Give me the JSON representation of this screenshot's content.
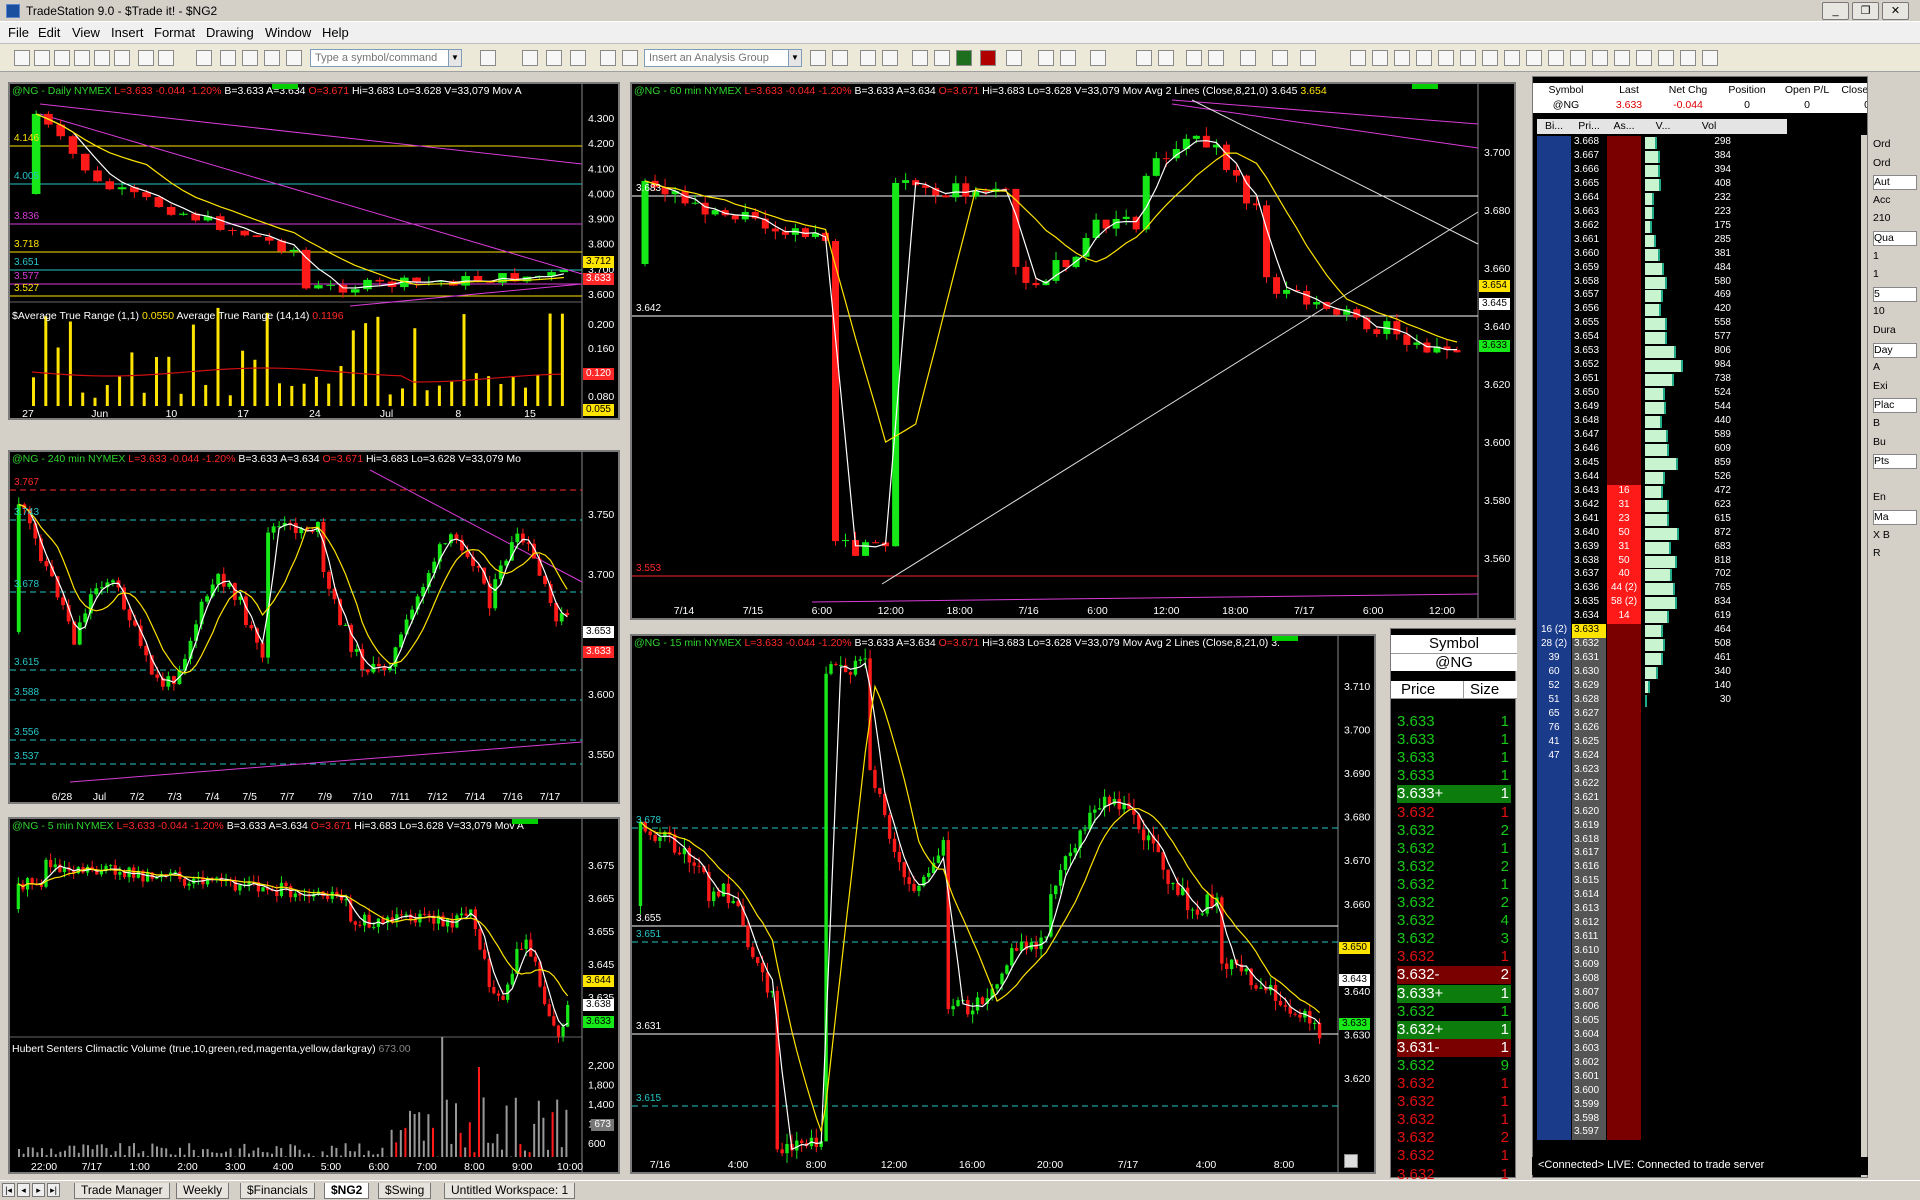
{
  "window": {
    "title": "TradeStation 9.0 - $Trade it! - $NG2",
    "min": "_",
    "max": "❐",
    "close": "✕"
  },
  "menu": [
    "File",
    "Edit",
    "View",
    "Insert",
    "Format",
    "Drawing",
    "Window",
    "Help"
  ],
  "toolbar": {
    "symbol_placeholder": "Type a symbol/command",
    "analysis_placeholder": "Insert an Analysis Group"
  },
  "charts": {
    "daily": {
      "title": "@NG - Daily NYMEX",
      "L": "L=3.633",
      "chg": "-0.044",
      "pct": "-1.20%",
      "B": "B=3.633",
      "A": "A=3.634",
      "O": "O=3.671",
      "Hi": "Hi=3.683",
      "Lo": "Lo=3.628",
      "V": "V=33,079",
      "extra": "Mov A",
      "levels": [
        {
          "v": "4.146",
          "c": "#ffe400"
        },
        {
          "v": "4.005",
          "c": "#27c6c6"
        },
        {
          "v": "3.836",
          "c": "#d83cd8"
        },
        {
          "v": "3.718",
          "c": "#ffe400"
        },
        {
          "v": "3.651",
          "c": "#27c6c6"
        },
        {
          "v": "3.577",
          "c": "#d83cd8"
        },
        {
          "v": "3.527",
          "c": "#ffe400"
        }
      ],
      "axis": [
        "4.300",
        "4.200",
        "4.100",
        "4.000",
        "3.900",
        "3.800",
        "3.700",
        "3.600"
      ],
      "x_labels": [
        "27",
        "Jun",
        "10",
        "17",
        "24",
        "Jul",
        "8",
        "15"
      ],
      "price_tags": {
        "yellow": "3.712",
        "red": "3.633"
      },
      "atr_text": "$Average True Range (1,1)",
      "atr1": "0.0550",
      "atr_text2": "Average True Range (14,14)",
      "atr2": "0.1196",
      "atr_axis": [
        "0.200",
        "0.160",
        "0.120",
        "0.080"
      ],
      "atr_tag_red": "0.120",
      "atr_tag_y": "0.055"
    },
    "h240": {
      "title": "@NG - 240 min NYMEX",
      "L": "L=3.633",
      "chg": "-0.044",
      "pct": "-1.20%",
      "B": "B=3.633",
      "A": "A=3.634",
      "O": "O=3.671",
      "Hi": "Hi=3.683",
      "Lo": "Lo=3.628",
      "V": "V=33,079",
      "extra": "Mo",
      "levels": [
        {
          "v": "3.767",
          "c": "#ff2828"
        },
        {
          "v": "3.743",
          "c": "#27c6c6"
        },
        {
          "v": "3.678",
          "c": "#27c6c6"
        },
        {
          "v": "3.615",
          "c": "#27c6c6"
        },
        {
          "v": "3.588",
          "c": "#27c6c6"
        },
        {
          "v": "3.556",
          "c": "#27c6c6"
        },
        {
          "v": "3.537",
          "c": "#27c6c6"
        }
      ],
      "axis": [
        "3.750",
        "3.700",
        "3.650",
        "3.600",
        "3.550"
      ],
      "x_labels": [
        "6/28",
        "Jul",
        "7/2",
        "7/3",
        "7/4",
        "7/5",
        "7/7",
        "7/9",
        "7/10",
        "7/11",
        "7/12",
        "7/14",
        "7/16",
        "7/17"
      ],
      "price_tags": {
        "white": "3.653",
        "red": "3.633"
      }
    },
    "m5": {
      "title": "@NG - 5 min NYMEX",
      "L": "L=3.633",
      "chg": "-0.044",
      "pct": "-1.20%",
      "B": "B=3.633",
      "A": "A=3.634",
      "O": "O=3.671",
      "Hi": "Hi=3.683",
      "Lo": "Lo=3.628",
      "V": "V=33,079",
      "extra": "Mov A",
      "axis": [
        "3.675",
        "3.665",
        "3.655",
        "3.645",
        "3.635"
      ],
      "x_labels": [
        "22:00",
        "7/17",
        "1:00",
        "2:00",
        "3:00",
        "4:00",
        "5:00",
        "6:00",
        "7:00",
        "8:00",
        "9:00",
        "10:00"
      ],
      "price_tags": {
        "yellow": "3.644",
        "white": "3.638",
        "green": "3.633"
      },
      "vol_text": "Hubert Senters Climactic Volume (true,10,green,red,magenta,yellow,darkgray)",
      "vol_val": "673.00",
      "vol_axis": [
        "2,200",
        "1,800",
        "1,400",
        "1,000",
        "600"
      ],
      "vol_tag": "673"
    },
    "m60": {
      "title": "@NG - 60 min NYMEX",
      "L": "L=3.633",
      "chg": "-0.044",
      "pct": "-1.20%",
      "B": "B=3.633",
      "A": "A=3.634",
      "O": "O=3.671",
      "Hi": "Hi=3.683",
      "Lo": "Lo=3.628",
      "V": "V=33,079",
      "extra": "Mov Avg 2 Lines (Close,8,21,0)",
      "ma1": "3.645",
      "ma2": "3.654",
      "levels": [
        {
          "v": "3.683",
          "c": "#ffffff"
        },
        {
          "v": "3.642",
          "c": "#ffffff"
        },
        {
          "v": "3.553",
          "c": "#ff2828"
        }
      ],
      "axis": [
        "3.700",
        "3.680",
        "3.660",
        "3.640",
        "3.620",
        "3.600",
        "3.580",
        "3.560"
      ],
      "x_labels": [
        "7/14",
        "7/15",
        "6:00",
        "12:00",
        "18:00",
        "7/16",
        "6:00",
        "12:00",
        "18:00",
        "7/17",
        "6:00",
        "12:00"
      ],
      "price_tags": {
        "yellow": "3.654",
        "white": "3.645",
        "green": "3.633"
      }
    },
    "m15": {
      "title": "@NG - 15 min NYMEX",
      "L": "L=3.633",
      "chg": "-0.044",
      "pct": "-1.20%",
      "B": "B=3.633",
      "A": "A=3.634",
      "O": "O=3.671",
      "Hi": "Hi=3.683",
      "Lo": "Lo=3.628",
      "V": "V=33,079",
      "extra": "Mov Avg 2 Lines (Close,8,21,0)",
      "extra2": "3.",
      "levels": [
        {
          "v": "3.678",
          "c": "#27c6c6"
        },
        {
          "v": "3.655",
          "c": "#ffffff"
        },
        {
          "v": "3.651",
          "c": "#27c6c6"
        },
        {
          "v": "3.631",
          "c": "#ffffff"
        },
        {
          "v": "3.615",
          "c": "#27c6c6"
        }
      ],
      "axis": [
        "3.710",
        "3.700",
        "3.690",
        "3.680",
        "3.670",
        "3.660",
        "3.650",
        "3.640",
        "3.630",
        "3.620"
      ],
      "x_labels": [
        "7/16",
        "4:00",
        "8:00",
        "12:00",
        "16:00",
        "20:00",
        "7/17",
        "4:00",
        "8:00"
      ],
      "price_tags": {
        "yellow": "3.650",
        "white": "3.643",
        "green": "3.633"
      }
    }
  },
  "time_sales": {
    "h1": "Symbol",
    "sym": "@NG",
    "h2": "Price",
    "h3": "Size",
    "rows": [
      {
        "p": "3.633",
        "s": "1",
        "c": "g"
      },
      {
        "p": "3.633",
        "s": "1",
        "c": "g"
      },
      {
        "p": "3.633",
        "s": "1",
        "c": "g"
      },
      {
        "p": "3.633",
        "s": "1",
        "c": "g"
      },
      {
        "p": "3.633+",
        "s": "1",
        "c": "gb"
      },
      {
        "p": "3.632",
        "s": "1",
        "c": "r"
      },
      {
        "p": "3.632",
        "s": "2",
        "c": "g"
      },
      {
        "p": "3.632",
        "s": "1",
        "c": "g"
      },
      {
        "p": "3.632",
        "s": "2",
        "c": "g"
      },
      {
        "p": "3.632",
        "s": "1",
        "c": "g"
      },
      {
        "p": "3.632",
        "s": "2",
        "c": "g"
      },
      {
        "p": "3.632",
        "s": "4",
        "c": "g"
      },
      {
        "p": "3.632",
        "s": "3",
        "c": "g"
      },
      {
        "p": "3.632",
        "s": "1",
        "c": "r"
      },
      {
        "p": "3.632-",
        "s": "2",
        "c": "rb"
      },
      {
        "p": "3.633+",
        "s": "1",
        "c": "gb"
      },
      {
        "p": "3.632",
        "s": "1",
        "c": "g"
      },
      {
        "p": "3.632+",
        "s": "1",
        "c": "gb"
      },
      {
        "p": "3.631-",
        "s": "1",
        "c": "rb"
      },
      {
        "p": "3.632",
        "s": "9",
        "c": "g"
      },
      {
        "p": "3.632",
        "s": "1",
        "c": "r"
      },
      {
        "p": "3.632",
        "s": "1",
        "c": "r"
      },
      {
        "p": "3.632",
        "s": "1",
        "c": "r"
      },
      {
        "p": "3.632",
        "s": "2",
        "c": "r"
      },
      {
        "p": "3.632",
        "s": "1",
        "c": "r"
      },
      {
        "p": "3.632",
        "s": "1",
        "c": "r"
      }
    ]
  },
  "dom": {
    "cols": [
      "Symbol",
      "Last",
      "Net Chg",
      "Position",
      "Open P/L",
      "Closed P/L"
    ],
    "row": [
      "@NG",
      "3.633",
      "-0.044",
      "0",
      "0",
      "0"
    ],
    "ladder_cols": [
      "Bi...",
      "Pri...",
      "As...",
      "V...",
      "Vol"
    ],
    "ladder": [
      [
        "",
        "3.668",
        "",
        "298"
      ],
      [
        "",
        "3.667",
        "",
        "384"
      ],
      [
        "",
        "3.666",
        "",
        "394"
      ],
      [
        "",
        "3.665",
        "",
        "408"
      ],
      [
        "",
        "3.664",
        "",
        "232"
      ],
      [
        "",
        "3.663",
        "",
        "223"
      ],
      [
        "",
        "3.662",
        "",
        "175"
      ],
      [
        "",
        "3.661",
        "",
        "285"
      ],
      [
        "",
        "3.660",
        "",
        "381"
      ],
      [
        "",
        "3.659",
        "",
        "484"
      ],
      [
        "",
        "3.658",
        "",
        "580"
      ],
      [
        "",
        "3.657",
        "",
        "469"
      ],
      [
        "",
        "3.656",
        "",
        "420"
      ],
      [
        "",
        "3.655",
        "",
        "558"
      ],
      [
        "",
        "3.654",
        "",
        "577"
      ],
      [
        "",
        "3.653",
        "",
        "806"
      ],
      [
        "",
        "3.652",
        "",
        "984"
      ],
      [
        "",
        "3.651",
        "",
        "738"
      ],
      [
        "",
        "3.650",
        "",
        "524"
      ],
      [
        "",
        "3.649",
        "",
        "544"
      ],
      [
        "",
        "3.648",
        "",
        "440"
      ],
      [
        "",
        "3.647",
        "",
        "589"
      ],
      [
        "",
        "3.646",
        "",
        "609"
      ],
      [
        "",
        "3.645",
        "",
        "859"
      ],
      [
        "",
        "3.644",
        "",
        "526"
      ],
      [
        "",
        "3.643",
        "16",
        "472"
      ],
      [
        "",
        "3.642",
        "31",
        "623"
      ],
      [
        "",
        "3.641",
        "23",
        "615"
      ],
      [
        "",
        "3.640",
        "50",
        "872"
      ],
      [
        "",
        "3.639",
        "31",
        "683"
      ],
      [
        "",
        "3.638",
        "50",
        "818"
      ],
      [
        "",
        "3.637",
        "40",
        "702"
      ],
      [
        "",
        "3.636",
        "44 (2)",
        "765"
      ],
      [
        "",
        "3.635",
        "58 (2)",
        "834"
      ],
      [
        "",
        "3.634",
        "14",
        "619"
      ],
      [
        "16 (2)",
        "3.633",
        "",
        "464"
      ],
      [
        "28 (2)",
        "3.632",
        "",
        "508"
      ],
      [
        "39",
        "3.631",
        "",
        "461"
      ],
      [
        "60",
        "3.630",
        "",
        "340"
      ],
      [
        "52",
        "3.629",
        "",
        "140"
      ],
      [
        "51",
        "3.628",
        "",
        "30"
      ],
      [
        "65",
        "3.627",
        "",
        ""
      ],
      [
        "76",
        "3.626",
        "",
        ""
      ],
      [
        "41",
        "3.625",
        "",
        ""
      ],
      [
        "47",
        "3.624",
        "",
        ""
      ],
      [
        "",
        "3.623",
        "",
        ""
      ],
      [
        "",
        "3.622",
        "",
        ""
      ],
      [
        "",
        "3.621",
        "",
        ""
      ],
      [
        "",
        "3.620",
        "",
        ""
      ],
      [
        "",
        "3.619",
        "",
        ""
      ],
      [
        "",
        "3.618",
        "",
        ""
      ],
      [
        "",
        "3.617",
        "",
        ""
      ],
      [
        "",
        "3.616",
        "",
        ""
      ],
      [
        "",
        "3.615",
        "",
        ""
      ],
      [
        "",
        "3.614",
        "",
        ""
      ],
      [
        "",
        "3.613",
        "",
        ""
      ],
      [
        "",
        "3.612",
        "",
        ""
      ],
      [
        "",
        "3.611",
        "",
        ""
      ],
      [
        "",
        "3.610",
        "",
        ""
      ],
      [
        "",
        "3.609",
        "",
        ""
      ],
      [
        "",
        "3.608",
        "",
        ""
      ],
      [
        "",
        "3.607",
        "",
        ""
      ],
      [
        "",
        "3.606",
        "",
        ""
      ],
      [
        "",
        "3.605",
        "",
        ""
      ],
      [
        "",
        "3.604",
        "",
        ""
      ],
      [
        "",
        "3.603",
        "",
        ""
      ],
      [
        "",
        "3.602",
        "",
        ""
      ],
      [
        "",
        "3.601",
        "",
        ""
      ],
      [
        "",
        "3.600",
        "",
        ""
      ],
      [
        "",
        "3.599",
        "",
        ""
      ],
      [
        "",
        "3.598",
        "",
        ""
      ],
      [
        "",
        "3.597",
        "",
        ""
      ]
    ],
    "status": "<Connected> LIVE:  Connected to trade server"
  },
  "side_panel": [
    "Ord",
    "Ord",
    "Aut",
    "Acc",
    "210",
    "Qua",
    "1",
    "1",
    "5",
    "10",
    "Dura",
    "Day",
    "A",
    "Exi",
    "Plac",
    "B",
    "Bu",
    "Pts",
    "",
    "En",
    "Ma",
    "X B",
    "R"
  ],
  "tabs": [
    "Trade Manager",
    "Weekly",
    "$Financials",
    "$NG2",
    "$Swing",
    "Untitled Workspace:  1"
  ],
  "active_tab": "$NG2"
}
